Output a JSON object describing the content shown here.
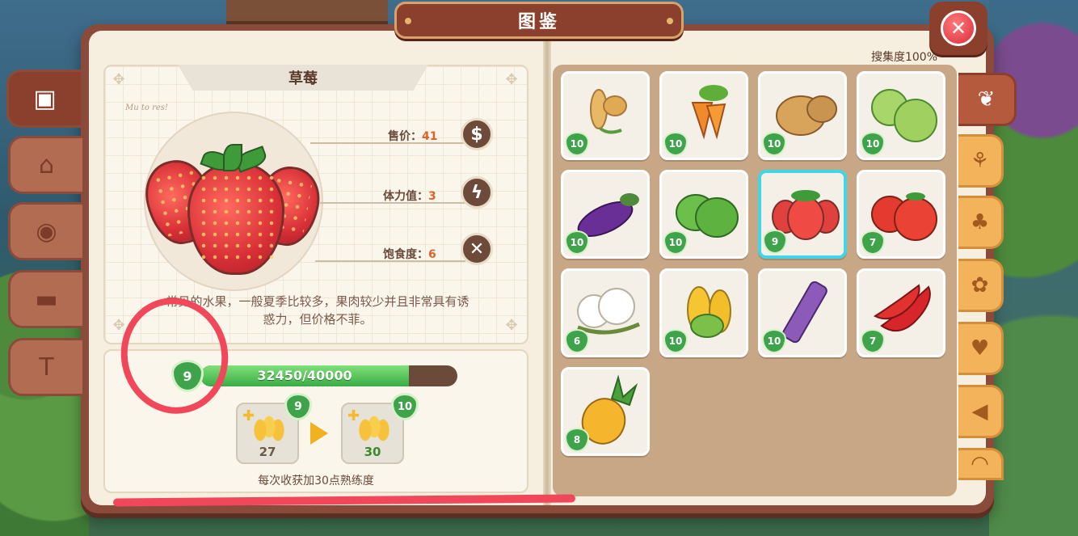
{
  "title": "图鉴",
  "close_icon": "close-x-icon",
  "collection_rate": "搜集度100%",
  "left_tabs": [
    {
      "name": "box",
      "icon": "box-icon",
      "glyph": "▣",
      "active": true
    },
    {
      "name": "house",
      "icon": "house-icon",
      "glyph": "⌂",
      "active": false
    },
    {
      "name": "owl",
      "icon": "owl-icon",
      "glyph": "◉",
      "active": false
    },
    {
      "name": "sofa",
      "icon": "sofa-icon",
      "glyph": "▬",
      "active": false
    },
    {
      "name": "shirt",
      "icon": "shirt-icon",
      "glyph": "T",
      "active": false
    }
  ],
  "right_tabs": [
    {
      "name": "crops",
      "icon": "wheat-bundle-icon",
      "glyph": "❦",
      "active": true
    },
    {
      "name": "grain",
      "icon": "grain-icon",
      "glyph": "⚘",
      "active": false
    },
    {
      "name": "trees",
      "icon": "trees-icon",
      "glyph": "♣",
      "active": false
    },
    {
      "name": "flower",
      "icon": "flower-icon",
      "glyph": "✿",
      "active": false
    },
    {
      "name": "chicken",
      "icon": "chicken-icon",
      "glyph": "♥",
      "active": false
    },
    {
      "name": "fish",
      "icon": "fish-icon",
      "glyph": "◀",
      "active": false
    },
    {
      "name": "shell",
      "icon": "shell-icon",
      "glyph": "◠",
      "active": false
    }
  ],
  "detail": {
    "name": "草莓",
    "scribble": "Mu to res!",
    "stats": [
      {
        "label": "售价：",
        "value": "41",
        "icon": "dollar-icon",
        "glyph": "$"
      },
      {
        "label": "体力值：",
        "value": "3",
        "icon": "lightning-icon",
        "glyph": "ϟ"
      },
      {
        "label": "饱食度：",
        "value": "6",
        "icon": "fork-spoon-icon",
        "glyph": "✕"
      }
    ],
    "description_line1": "常见的水果，一般夏季比较多，果肉较少并且非常具有诱",
    "description_line2": "惑力，但价格不菲。"
  },
  "proficiency": {
    "level": "9",
    "progress_text": "32450/40000",
    "progress_fraction": 0.811,
    "current": {
      "level": "9",
      "amount": "27"
    },
    "next": {
      "level": "10",
      "amount": "30"
    },
    "note": "每次收获加30点熟练度"
  },
  "crops": [
    {
      "name": "wheat",
      "level": "10",
      "selected": false
    },
    {
      "name": "carrot",
      "level": "10",
      "selected": false
    },
    {
      "name": "potato",
      "level": "10",
      "selected": false
    },
    {
      "name": "cabbage",
      "level": "10",
      "selected": false
    },
    {
      "name": "eggplant",
      "level": "10",
      "selected": false
    },
    {
      "name": "watermelon",
      "level": "10",
      "selected": false
    },
    {
      "name": "strawberry",
      "level": "9",
      "selected": true
    },
    {
      "name": "tomato",
      "level": "7",
      "selected": false
    },
    {
      "name": "cotton",
      "level": "6",
      "selected": false
    },
    {
      "name": "corn",
      "level": "10",
      "selected": false
    },
    {
      "name": "sugarcane",
      "level": "10",
      "selected": false
    },
    {
      "name": "chili",
      "level": "7",
      "selected": false
    },
    {
      "name": "pineapple",
      "level": "8",
      "selected": false
    }
  ]
}
